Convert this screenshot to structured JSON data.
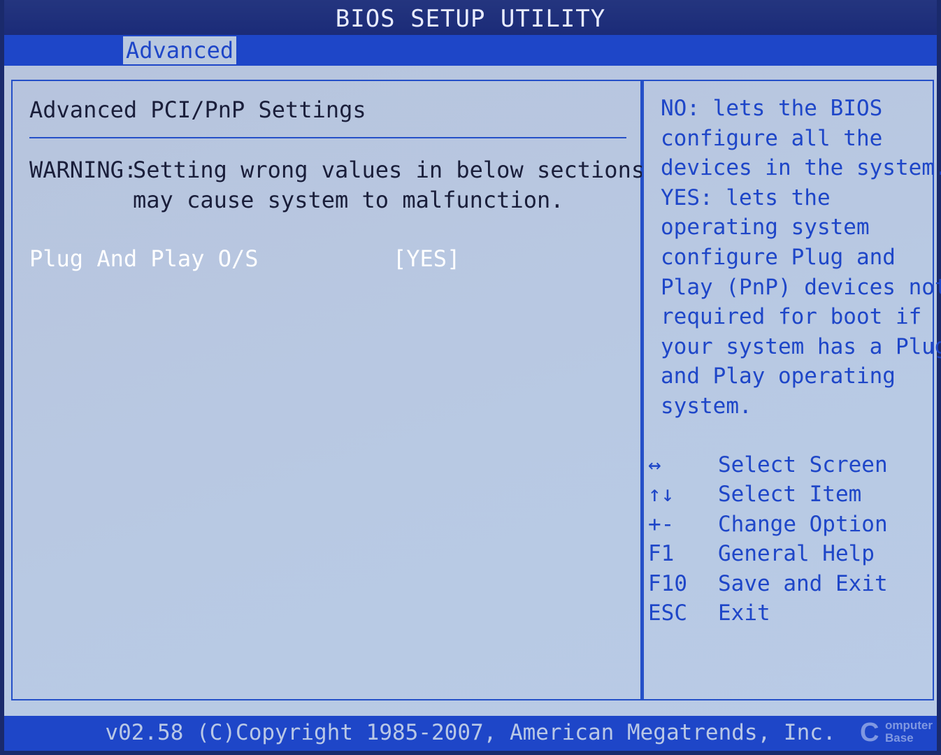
{
  "window": {
    "title": "BIOS SETUP UTILITY"
  },
  "menu": {
    "tabs": [
      {
        "label": "Advanced",
        "active": true
      }
    ]
  },
  "main": {
    "section_title": "Advanced PCI/PnP Settings",
    "warning_label": "WARNING:",
    "warning_lines": [
      "Setting wrong values in below sections",
      "may cause system to malfunction."
    ],
    "settings": [
      {
        "label": "Plug And Play O/S",
        "value": "[YES]"
      }
    ]
  },
  "help": {
    "lines": [
      "NO: lets the BIOS",
      "configure all the",
      "devices in the system.",
      "YES: lets the",
      "operating system",
      "configure Plug and",
      "Play (PnP) devices not",
      "required for boot if",
      "your system has a Plug",
      "and Play operating",
      "system."
    ]
  },
  "keys": [
    {
      "key": "↔",
      "desc": "Select Screen"
    },
    {
      "key": "↑↓",
      "desc": "Select Item"
    },
    {
      "key": "+-",
      "desc": "Change Option"
    },
    {
      "key": "F1",
      "desc": "General Help"
    },
    {
      "key": "F10",
      "desc": "Save and Exit"
    },
    {
      "key": "ESC",
      "desc": "Exit"
    }
  ],
  "footer": {
    "copyright": "v02.58 (C)Copyright 1985-2007, American Megatrends, Inc."
  },
  "watermark": {
    "letter": "C",
    "line1": "omputer",
    "line2": "Base"
  },
  "colors": {
    "menubar": "#1e46c8",
    "panel_bg": "#b8c9e3",
    "help_text": "#1e46c8",
    "selected_text": "#ffffff"
  }
}
